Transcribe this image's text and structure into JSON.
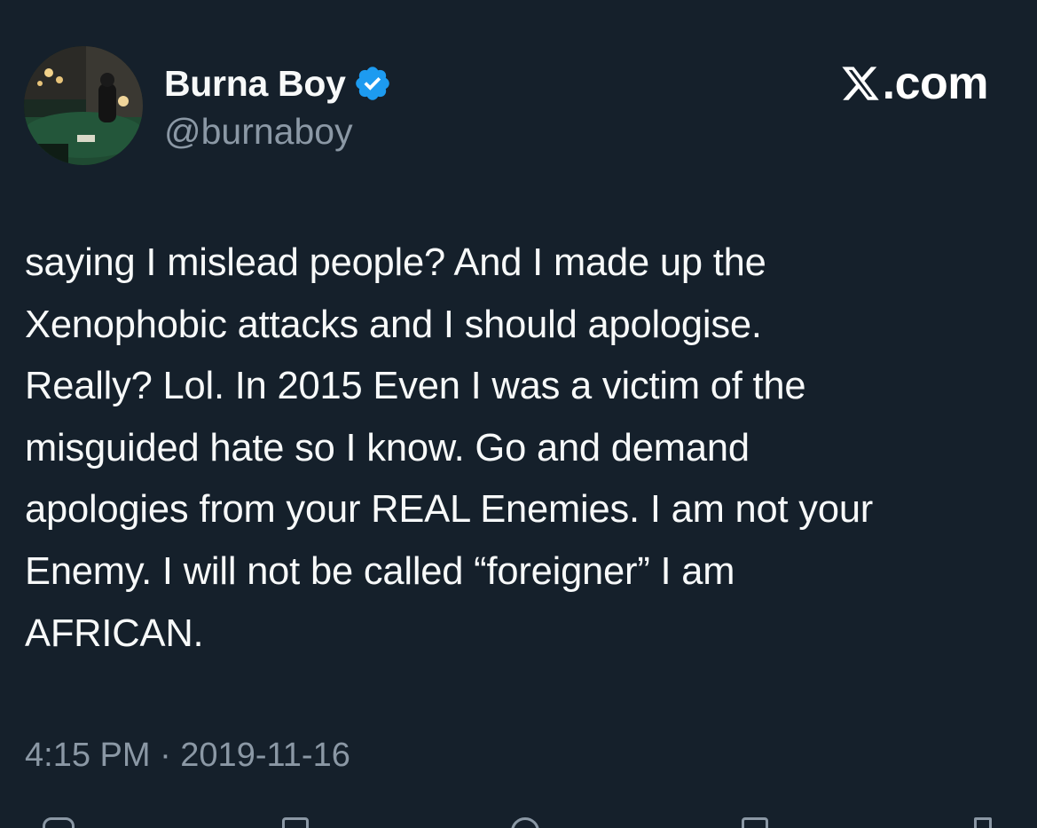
{
  "author": {
    "display_name": "Burna Boy",
    "handle": "@burnaboy",
    "verified_icon": "verified-badge-icon",
    "accent_color": "#1d9bf0"
  },
  "brand": {
    "logo_icon": "x-logo-icon",
    "text": ".com"
  },
  "tweet": {
    "text": "saying I mislead people? And I made up the\nXenophobic attacks  and I should apologise.\nReally? Lol. In 2015 Even I was a victim of the\nmisguided hate so I know. Go and demand\napologies from your REAL Enemies. I am not your\nEnemy. I will not be called “foreigner” I am\nAFRICAN.",
    "timestamp": "4:15 PM · 2019-11-16"
  },
  "actions": {
    "icons": [
      "reply-icon",
      "retweet-icon",
      "like-icon",
      "bookmark-icon",
      "share-icon"
    ]
  },
  "colors": {
    "background": "#15202b",
    "primary_text": "#f7f9f9",
    "secondary_text": "#8b98a5"
  }
}
